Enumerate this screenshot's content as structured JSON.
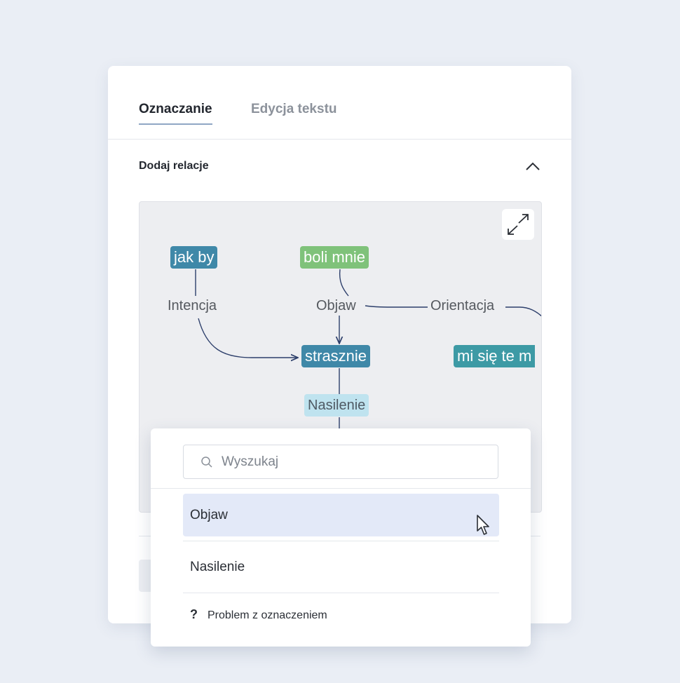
{
  "tabs": [
    {
      "label": "Oznaczanie",
      "active": true
    },
    {
      "label": "Edycja tekstu",
      "active": false
    }
  ],
  "section": {
    "title": "Dodaj relacje",
    "collapse_icon": "chevron-up-icon"
  },
  "graph": {
    "expand_icon": "expand-icon",
    "nodes": {
      "jak_by": "jak by",
      "boli_mnie": "boli mnie",
      "strasznie": "strasznie",
      "mi_sie": "mi się te m"
    },
    "relations": {
      "intencja": "Intencja",
      "objaw": "Objaw",
      "orientacja": "Orientacja",
      "nasilenie": "Nasilenie"
    },
    "colors": {
      "blue_node": "#3f88a8",
      "green_node": "#7fc27a",
      "teal_node": "#3d9aa5",
      "chip": "#bfe3ef",
      "link": "#2d3f6b"
    }
  },
  "dropdown": {
    "search_placeholder": "Wyszukaj",
    "search_icon": "search-icon",
    "options": [
      {
        "label": "Objaw",
        "highlighted": true
      },
      {
        "label": "Nasilenie",
        "highlighted": false
      }
    ],
    "problem": {
      "icon": "?",
      "label": "Problem z oznaczeniem"
    }
  }
}
